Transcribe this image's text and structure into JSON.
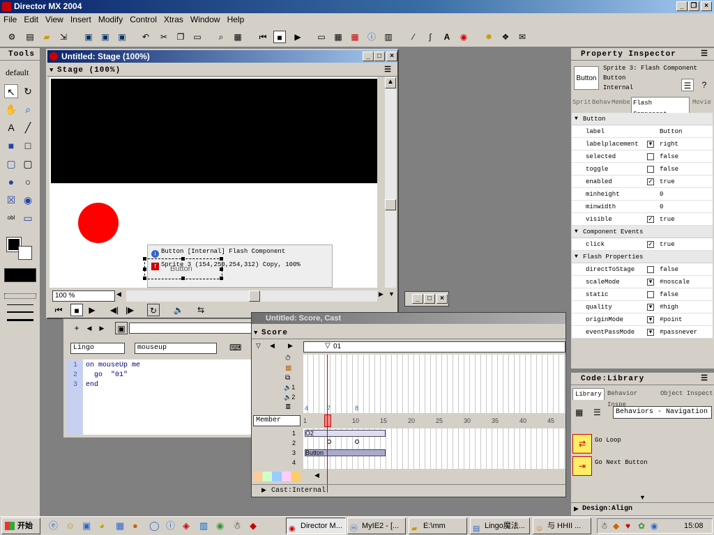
{
  "app": {
    "title": "Director MX 2004"
  },
  "menu": [
    "File",
    "Edit",
    "View",
    "Insert",
    "Modify",
    "Control",
    "Xtras",
    "Window",
    "Help"
  ],
  "tools": {
    "title": "Tools",
    "mode": "default"
  },
  "stage": {
    "window_title": "Untitled: Stage (100%)",
    "header": "Stage (100%)",
    "zoom": "100 %",
    "tooltip_line1": "Button [Internal] Flash Component",
    "tooltip_line2": "Sprite 3  (154,250,254,312) Copy, 100%",
    "button_label": "Button"
  },
  "script": {
    "lang": "Lingo",
    "handler": "mouseup",
    "lines": [
      "on mouseUp me",
      "  go  \"01\"",
      "end"
    ],
    "line_numbers": [
      "1",
      "2",
      "3"
    ]
  },
  "score": {
    "window_title": "Untitled: Score, Cast",
    "header": "Score",
    "marker": "01",
    "member_select": "Member",
    "channel_nums": [
      "1",
      "2"
    ],
    "frame_labels": [
      "1",
      "5",
      "10",
      "15",
      "20",
      "25",
      "30",
      "35",
      "40",
      "45"
    ],
    "sprite_channels": [
      "1",
      "2",
      "3",
      "4"
    ],
    "sprite_o2": "O2",
    "sprite_button": "Button",
    "marker_nums": [
      "4",
      "7",
      "8"
    ],
    "cast_label": "Cast:Internal"
  },
  "pi": {
    "title": "Property Inspector",
    "sprite_line": "Sprite 3: Flash Component",
    "type": "Button",
    "cast": "Internal",
    "thumb": "Button",
    "tabs": [
      "Sprit",
      "Behav",
      "Membe",
      "Flash Component",
      "Movie"
    ],
    "sections": {
      "button": "Button",
      "events": "Component Events",
      "flash": "Flash Properties"
    },
    "rows": [
      {
        "k": "label",
        "v": "Button"
      },
      {
        "k": "labelplacement",
        "v": "right"
      },
      {
        "k": "selected",
        "v": "false"
      },
      {
        "k": "toggle",
        "v": "false"
      },
      {
        "k": "enabled",
        "v": "true"
      },
      {
        "k": "minheight",
        "v": "0"
      },
      {
        "k": "minwidth",
        "v": "0"
      },
      {
        "k": "visible",
        "v": "true"
      }
    ],
    "event_rows": [
      {
        "k": "click",
        "v": "true"
      }
    ],
    "flash_rows": [
      {
        "k": "directToStage",
        "v": "false"
      },
      {
        "k": "scaleMode",
        "v": "#noscale"
      },
      {
        "k": "static",
        "v": "false"
      },
      {
        "k": "quality",
        "v": "#high"
      },
      {
        "k": "originMode",
        "v": "#point"
      },
      {
        "k": "eventPassMode",
        "v": "#passnever"
      }
    ]
  },
  "library": {
    "title": "Code:Library",
    "tabs": [
      "Library",
      "Behavior Inspe",
      "Object Inspect"
    ],
    "category": "Behaviors - Navigation",
    "items": [
      "Go Loop",
      "Go Next Button"
    ],
    "design": "Design:Align"
  },
  "taskbar": {
    "start": "开始",
    "items": [
      "Director M...",
      "MyIE2 - [...",
      "E:\\mm",
      "Lingo魔法...",
      "与 HHII ..."
    ],
    "time": "15:08"
  },
  "colors": {
    "accent": "#0a246a",
    "circle": "#ff0000",
    "stage_bg": "#000000"
  }
}
